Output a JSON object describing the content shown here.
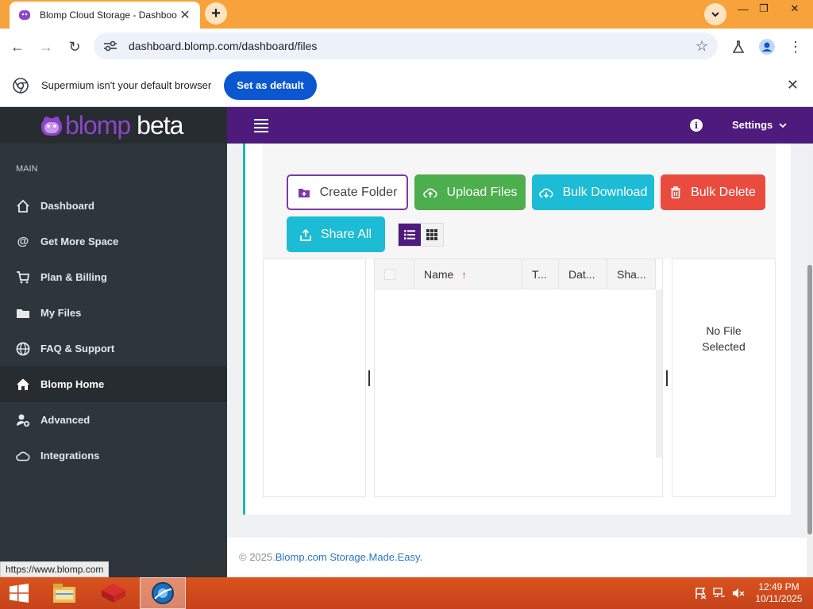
{
  "browser": {
    "tab_title": "Blomp Cloud Storage - Dashboo",
    "tab_close": "✕",
    "new_tab": "+",
    "url": "dashboard.blomp.com/dashboard/files",
    "minimize": "—",
    "restore": "❐",
    "close": "✕"
  },
  "infobar": {
    "message": "Supermium isn't your default browser",
    "button": "Set as default",
    "close": "✕"
  },
  "sidebar": {
    "brand_blomp": "blomp",
    "brand_beta": "beta",
    "section_label": "MAIN",
    "items": [
      {
        "label": "Dashboard",
        "icon": "home-outline-icon"
      },
      {
        "label": "Get More Space",
        "icon": "at-icon"
      },
      {
        "label": "Plan & Billing",
        "icon": "cart-icon"
      },
      {
        "label": "My Files",
        "icon": "folder-icon"
      },
      {
        "label": "FAQ & Support",
        "icon": "globe-icon"
      },
      {
        "label": "Blomp Home",
        "icon": "home-icon",
        "active": true
      },
      {
        "label": "Advanced",
        "icon": "user-plus-icon"
      },
      {
        "label": "Integrations",
        "icon": "cloud-icon"
      }
    ],
    "status_url": "https://www.blomp.com"
  },
  "header": {
    "info": "i",
    "settings": "Settings"
  },
  "toolbar": {
    "create_folder": "Create Folder",
    "upload_files": "Upload Files",
    "bulk_download": "Bulk Download",
    "bulk_delete": "Bulk Delete",
    "share_all": "Share All"
  },
  "grid": {
    "columns": [
      "Name",
      "T...",
      "Dat...",
      "Sha..."
    ],
    "sort_arrow": "↑"
  },
  "details": {
    "empty_line1": "No File",
    "empty_line2": "Selected"
  },
  "footer": {
    "prefix": "© 2025.",
    "link": "Blomp.com Storage.Made.Easy."
  },
  "taskbar": {
    "time": "12:49 PM",
    "date": "10/11/2025"
  },
  "colors": {
    "header_purple": "#4e1a7c",
    "sidebar_dark": "#2f363b",
    "accent_teal": "#1fb7a6",
    "green": "#4cae4c",
    "cyan": "#1bbcd4",
    "red": "#ea4b3f"
  }
}
